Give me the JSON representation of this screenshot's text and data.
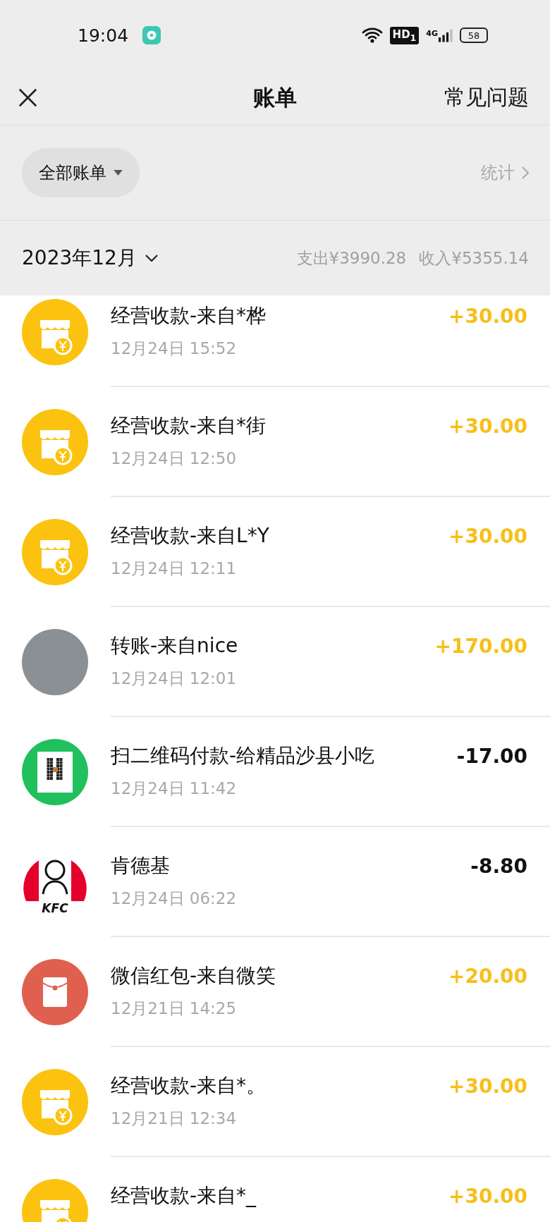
{
  "status_bar": {
    "time": "19:04",
    "hd_badge": "HD$_{1}$",
    "network": "4G",
    "battery": "58"
  },
  "header": {
    "title": "账单",
    "help_link": "常见问题"
  },
  "filter": {
    "dropdown": "全部账单",
    "stats_link": "统计"
  },
  "month_bar": {
    "month": "2023年12月",
    "expense": "支出¥3990.28",
    "income": "收入¥5355.14"
  },
  "transactions": [
    {
      "kind": "shop",
      "title": "经营收款-来自*桦",
      "time": "12月24日 15:52",
      "amount": "+30.00",
      "income": true
    },
    {
      "kind": "shop",
      "title": "经营收款-来自*街",
      "time": "12月24日 12:50",
      "amount": "+30.00",
      "income": true
    },
    {
      "kind": "shop",
      "title": "经营收款-来自L*Y",
      "time": "12月24日 12:11",
      "amount": "+30.00",
      "income": true
    },
    {
      "kind": "photo",
      "title": "转账-来自nice",
      "time": "12月24日 12:01",
      "amount": "+170.00",
      "income": true
    },
    {
      "kind": "qr",
      "title": "扫二维码付款-给精品沙县小吃",
      "time": "12月24日 11:42",
      "amount": "-17.00",
      "income": false
    },
    {
      "kind": "kfc",
      "title": "肯德基",
      "time": "12月24日 06:22",
      "amount": "-8.80",
      "income": false,
      "logo_text": "KFC"
    },
    {
      "kind": "red_packet",
      "title": "微信红包-来自微笑",
      "time": "12月21日 14:25",
      "amount": "+20.00",
      "income": true
    },
    {
      "kind": "shop",
      "title": "经营收款-来自*。",
      "time": "12月21日 12:34",
      "amount": "+30.00",
      "income": true
    },
    {
      "kind": "shop",
      "title": "经营收款-来自*_",
      "amount": "+30.00",
      "income": true
    }
  ]
}
